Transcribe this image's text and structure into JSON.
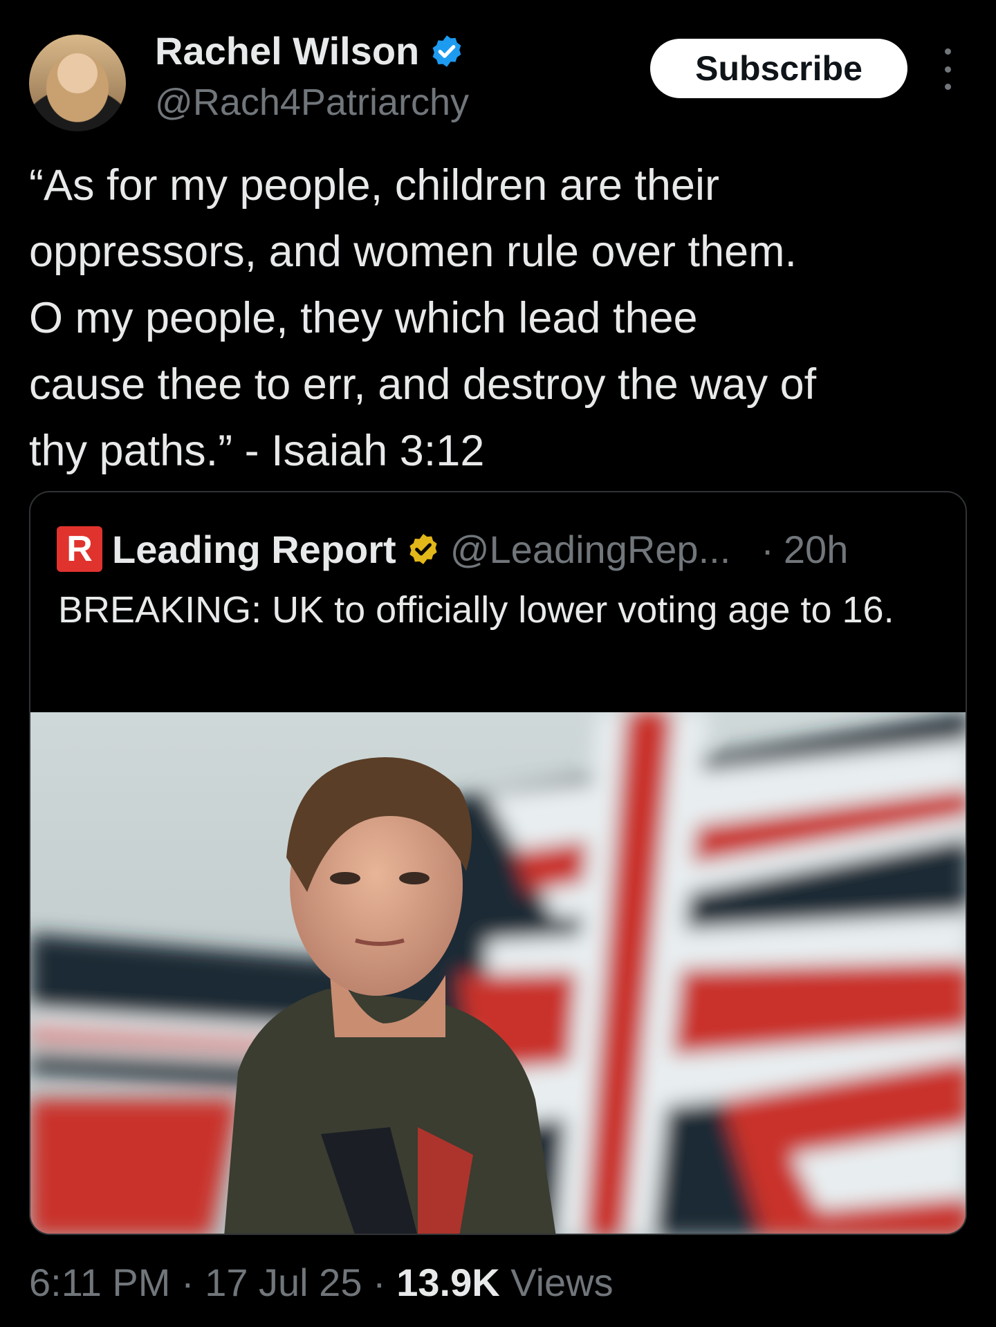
{
  "author": {
    "name": "Rachel Wilson",
    "handle": "@Rach4Patriarchy",
    "verified_color": "#1d9bf0"
  },
  "subscribe_label": "Subscribe",
  "tweet_text": "“As for my people, children are their\noppressors, and women rule over them.\nO my people, they which lead thee\ncause thee to err, and destroy the way of\nthy paths.” - Isaiah 3:12",
  "quote": {
    "logo_letter": "R",
    "name": "Leading Report",
    "verified_color": "#e2b719",
    "handle": "@LeadingRep...",
    "separator": "·",
    "time": "20h",
    "text": "BREAKING: UK to officially lower voting age to 16."
  },
  "meta": {
    "time": "6:11 PM",
    "sep1": "·",
    "date": "17 Jul 25",
    "sep2": "·",
    "views_count": "13.9K",
    "views_label": "Views"
  }
}
